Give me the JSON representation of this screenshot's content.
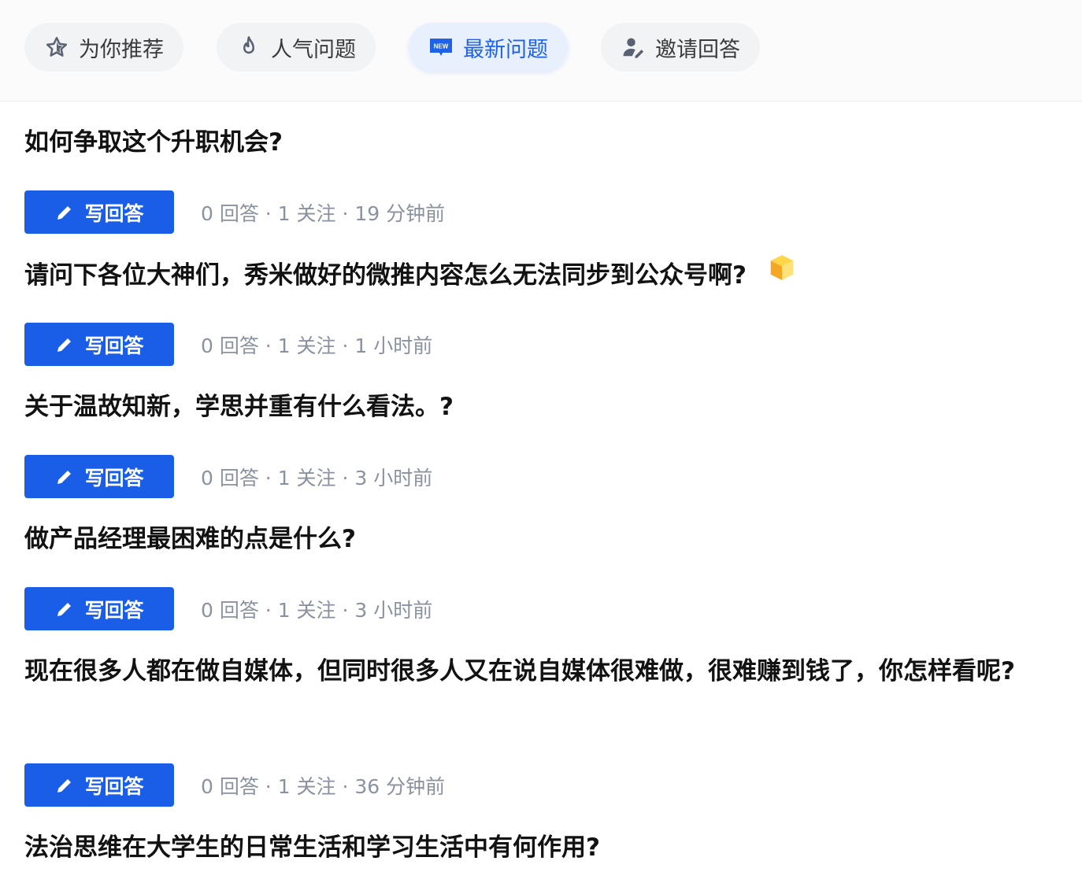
{
  "tabs": [
    {
      "label": "为你推荐",
      "icon": "star-icon",
      "active": false
    },
    {
      "label": "人气问题",
      "icon": "fire-icon",
      "active": false
    },
    {
      "label": "最新问题",
      "icon": "new-badge-icon",
      "active": true
    },
    {
      "label": "邀请回答",
      "icon": "invite-user-icon",
      "active": false
    }
  ],
  "new_badge_text": "NEW",
  "answer_button_label": "写回答",
  "questions": [
    {
      "title": "如何争取这个升职机会?",
      "answers": "0 回答",
      "follows": "1 关注",
      "time": "19 分钟前"
    },
    {
      "title": "请问下各位大神们，秀米做好的微推内容怎么无法同步到公众号啊?",
      "answers": "0 回答",
      "follows": "1 关注",
      "time": "1 小时前",
      "emoji": "cube-emoji-icon"
    },
    {
      "title": "关于温故知新，学思并重有什么看法。?",
      "answers": "0 回答",
      "follows": "1 关注",
      "time": "3 小时前"
    },
    {
      "title": "做产品经理最困难的点是什么?",
      "answers": "0 回答",
      "follows": "1 关注",
      "time": "3 小时前"
    },
    {
      "title": "现在很多人都在做自媒体，但同时很多人又在说自媒体很难做，很难赚到钱了，你怎样看呢?",
      "answers": "0 回答",
      "follows": "1 关注",
      "time": "36 分钟前"
    },
    {
      "title": "法治思维在大学生的日常生活和学习生活中有何作用?"
    }
  ],
  "colors": {
    "accent": "#1a5ee8",
    "active_tab_bg": "#e8f0fe",
    "tab_bg": "#f2f3f5",
    "meta_text": "#8a919f"
  }
}
